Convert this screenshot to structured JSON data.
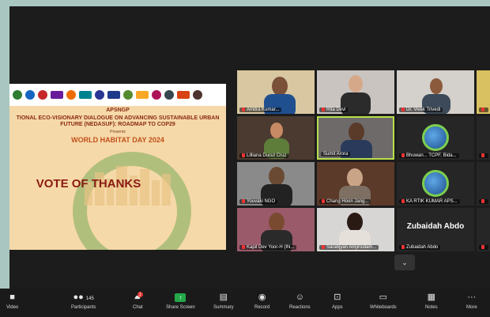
{
  "slide": {
    "org": "APSNGP",
    "title": "TIONAL ECO-VISIONARY DIALOGUE ON ADVANCING SUSTAINABLE URBAN FUTURE (NEDASUF): ROADMAP TO COP29",
    "presents": "Presents",
    "event": "WORLD HABITAT DAY 2024",
    "vote": "VOTE OF THANKS"
  },
  "participants": [
    {
      "name": "Amitra Kumar..."
    },
    {
      "name": "Rita Devi"
    },
    {
      "name": "Dr. Vivek Trivedi"
    },
    {
      "name": ""
    },
    {
      "name": "Lilliana Ducut Cruz"
    },
    {
      "name": "Sumit Arora"
    },
    {
      "name": "Bhuwan... TCPF, Bida..."
    },
    {
      "name": ""
    },
    {
      "name": "Youvaki NGO"
    },
    {
      "name": "Chang Hoon Jang..."
    },
    {
      "name": "KA RTIK KUMAR APS..."
    },
    {
      "name": ""
    },
    {
      "name": "Kapil Dev Yoor-H (IN..."
    },
    {
      "name": "Sarabjyan Amjiroidam..."
    },
    {
      "name": "Zubaidah Abdo"
    },
    {
      "name": ""
    }
  ],
  "big_name": "Zubaidah Abdo",
  "more": "⌄",
  "toolbar": {
    "video": "Video",
    "participants": "Participants",
    "participants_count": "145",
    "chat": "Chat",
    "chat_badge": "1",
    "share": "Share Screen",
    "summary": "Summary",
    "record": "Record",
    "reactions": "Reactions",
    "apps": "Apps",
    "whiteboards": "Whiteboards",
    "notes": "Notes",
    "more": "More"
  }
}
